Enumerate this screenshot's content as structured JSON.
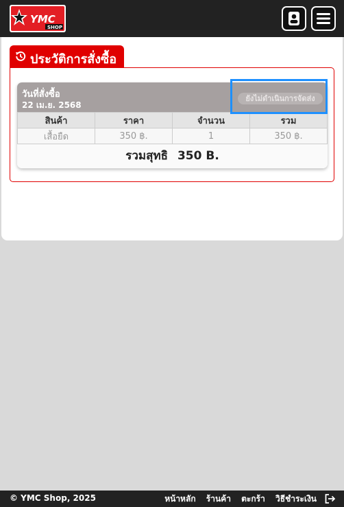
{
  "header": {
    "logo_text": "YMC",
    "logo_subtext": "SHOP",
    "account_icon": "account-icon",
    "menu_icon": "hamburger-menu-icon"
  },
  "section": {
    "icon": "history-icon",
    "title": "ประวัติการสั่งซื้อ"
  },
  "order": {
    "date_label": "วันที่สั่งซื้อ",
    "date_value": "22 เม.ย. 2568",
    "status": "ยังไม่ดำเนินการจัดส่ง",
    "columns": [
      "สินค้า",
      "ราคา",
      "จำนวน",
      "รวม"
    ],
    "rows": [
      [
        "เสื้อยืด",
        "350 ฿.",
        "1",
        "350 ฿."
      ]
    ],
    "total_label": "รวมสุทธิ",
    "total_value": "350 B."
  },
  "footer": {
    "copyright": "© YMC Shop, 2025",
    "links": [
      "หน้าหลัก",
      "ร้านค้า",
      "ตะกร้า",
      "วิธีชำระเงิน"
    ],
    "logout_icon": "logout-icon"
  },
  "colors": {
    "brand_red": "#e00000",
    "highlight_blue": "#1e90ff",
    "header_dark": "#222222"
  }
}
